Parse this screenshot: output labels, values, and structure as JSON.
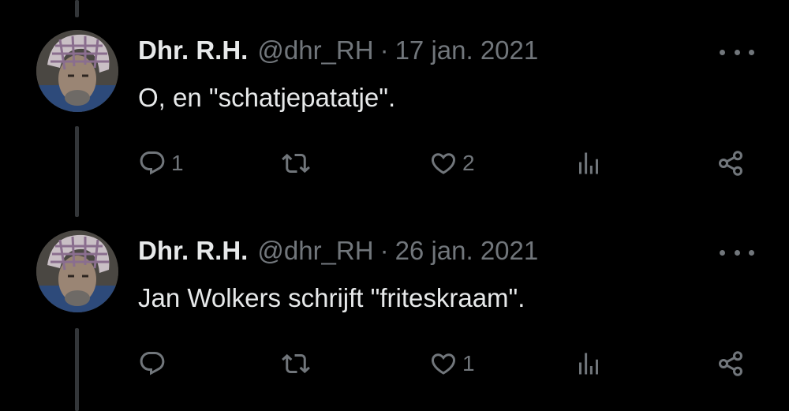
{
  "tweets": [
    {
      "author_name": "Dhr. R.H.",
      "handle": "@dhr_RH",
      "separator": "·",
      "date": "17 jan. 2021",
      "text": "O, en \"schatjepatatje\".",
      "reply_count": "1",
      "retweet_count": "",
      "like_count": "2"
    },
    {
      "author_name": "Dhr. R.H.",
      "handle": "@dhr_RH",
      "separator": "·",
      "date": "26 jan. 2021",
      "text": "Jan Wolkers schrijft \"friteskraam\".",
      "reply_count": "",
      "retweet_count": "",
      "like_count": "1"
    }
  ],
  "icons": {
    "reply": "reply-icon",
    "retweet": "retweet-icon",
    "like": "heart-icon",
    "views": "views-icon",
    "share": "share-icon",
    "more": "more-icon"
  },
  "colors": {
    "background": "#000000",
    "text_primary": "#e7e9ea",
    "text_secondary": "#71767b",
    "thread_line": "#333639"
  }
}
